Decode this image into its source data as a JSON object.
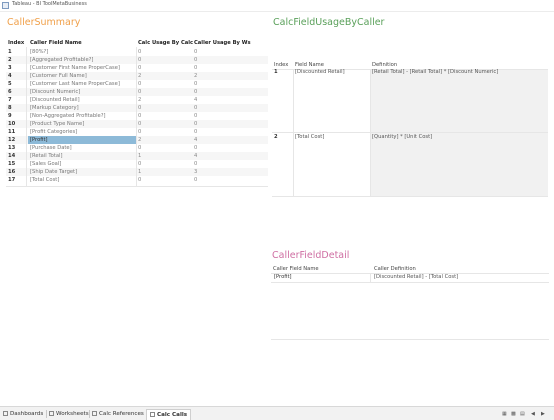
{
  "window": {
    "title": "Tableau - BI ToolMetaBusiness"
  },
  "caller_summary": {
    "title": "CallerSummary",
    "headers": [
      "Index",
      "Caller Field Name",
      "Calc Usage By Calc",
      "Caller Usage By Ws"
    ],
    "rows": [
      {
        "index": "1",
        "name": "[80%?]",
        "calc": "0",
        "ws": "0"
      },
      {
        "index": "2",
        "name": "[Aggregated Profitable?]",
        "calc": "0",
        "ws": "0"
      },
      {
        "index": "3",
        "name": "[Customer First Name ProperCase]",
        "calc": "0",
        "ws": "0"
      },
      {
        "index": "4",
        "name": "[Customer Full Name]",
        "calc": "2",
        "ws": "2"
      },
      {
        "index": "5",
        "name": "[Customer Last Name ProperCase]",
        "calc": "0",
        "ws": "0"
      },
      {
        "index": "6",
        "name": "[Discount Numeric]",
        "calc": "0",
        "ws": "0"
      },
      {
        "index": "7",
        "name": "[Discounted Retail]",
        "calc": "2",
        "ws": "4"
      },
      {
        "index": "8",
        "name": "[Markup Category]",
        "calc": "0",
        "ws": "0"
      },
      {
        "index": "9",
        "name": "[Non-Aggregated Profitable?]",
        "calc": "0",
        "ws": "0"
      },
      {
        "index": "10",
        "name": "[Product Type Name]",
        "calc": "0",
        "ws": "0"
      },
      {
        "index": "11",
        "name": "[Profit Categories]",
        "calc": "0",
        "ws": "0"
      },
      {
        "index": "12",
        "name": "[Profit]",
        "calc": "2",
        "ws": "4",
        "selected": true
      },
      {
        "index": "13",
        "name": "[Purchase Date]",
        "calc": "0",
        "ws": "0"
      },
      {
        "index": "14",
        "name": "[Retail Total]",
        "calc": "1",
        "ws": "4"
      },
      {
        "index": "15",
        "name": "[Sales Goal]",
        "calc": "0",
        "ws": "0"
      },
      {
        "index": "16",
        "name": "[Ship Date Target]",
        "calc": "1",
        "ws": "3"
      },
      {
        "index": "17",
        "name": "[Total Cost]",
        "calc": "0",
        "ws": "0"
      }
    ]
  },
  "calc_field_usage": {
    "title": "CalcFieldUsageByCaller",
    "headers": [
      "Index",
      "Field Name",
      "Definition"
    ],
    "rows": [
      {
        "index": "1",
        "name": "[Discounted Retail]",
        "definition": "[Retail Total] - [Retail Total] * [Discount Numeric]"
      },
      {
        "index": "2",
        "name": "[Total Cost]",
        "definition": "[Quantity] * [Unit Cost]"
      }
    ]
  },
  "caller_field_detail": {
    "title": "CallerFieldDetail",
    "headers": [
      "Caller Field Name",
      "Caller Definition"
    ],
    "rows": [
      {
        "name": "[Profit]",
        "definition": "[Discounted Retail] - [Total Cost]"
      }
    ]
  },
  "tabs": [
    {
      "label": "Dashboards",
      "icon": "dashboard-icon"
    },
    {
      "label": "Worksheets",
      "icon": "worksheet-icon"
    },
    {
      "label": "Calc References",
      "icon": "dashboard-icon"
    },
    {
      "label": "Calc Calls",
      "icon": "dashboard-icon",
      "active": true
    }
  ]
}
